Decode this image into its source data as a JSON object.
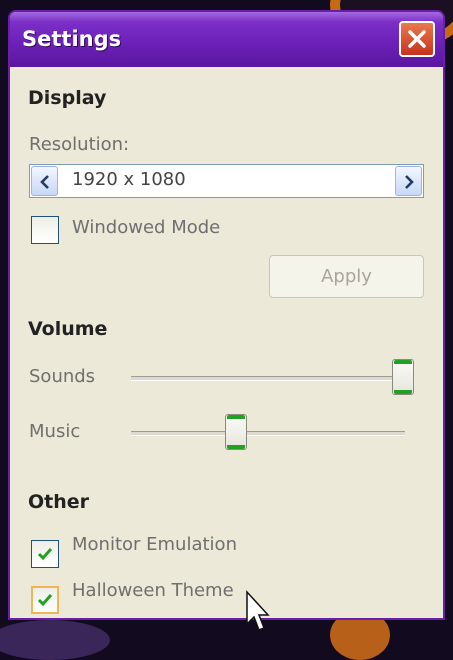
{
  "window": {
    "title": "Settings",
    "close_icon": "close-icon",
    "accent": "#6a1fb6"
  },
  "display": {
    "heading": "Display",
    "resolution_label": "Resolution:",
    "resolution_value": "1920 x 1080",
    "windowed_mode": {
      "label": "Windowed Mode",
      "checked": false
    },
    "apply_label": "Apply",
    "apply_enabled": false
  },
  "volume": {
    "heading": "Volume",
    "sounds_label": "Sounds",
    "sounds_level": 1.0,
    "music_label": "Music",
    "music_level": 0.4
  },
  "other": {
    "heading": "Other",
    "monitor_emulation": {
      "label": "Monitor Emulation",
      "checked": true
    },
    "halloween_theme": {
      "label": "Halloween Theme",
      "checked": true
    }
  },
  "colors": {
    "window_bg": "#ece9d8",
    "check": "#21a121",
    "slider_thumb_accent": "#21a121"
  }
}
